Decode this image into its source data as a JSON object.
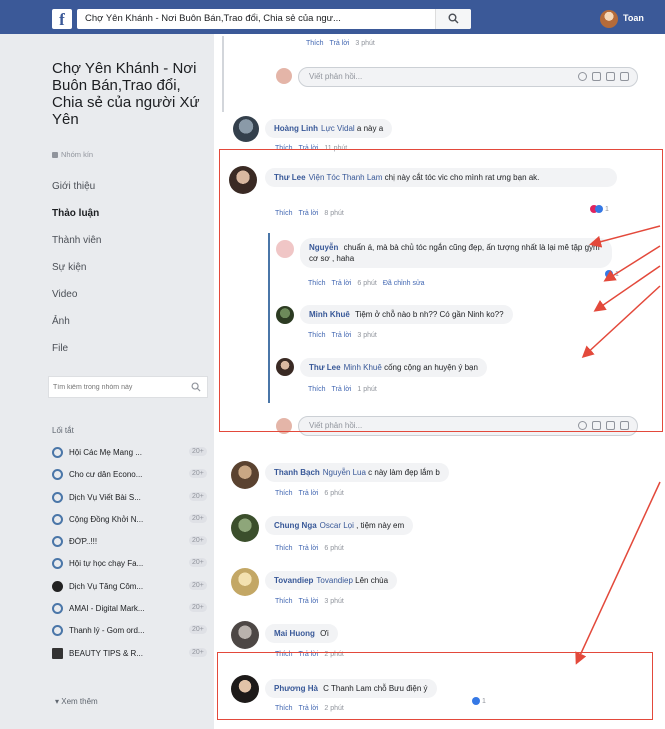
{
  "topbar": {
    "logo": "f",
    "search_value": "Chợ Yên Khánh - Nơi Buôn Bán,Trao đổi, Chia sẻ của ngư...",
    "user_name": "Toan"
  },
  "sidebar": {
    "group_title": "Chợ Yên Khánh - Nơi Buôn Bán,Trao đổi, Chia sẻ của người Xứ Yên",
    "group_type": "Nhóm kín",
    "nav": [
      "Giới thiệu",
      "Thảo luận",
      "Thành viên",
      "Sự kiện",
      "Video",
      "Ảnh",
      "File"
    ],
    "active_nav": "Thảo luận",
    "search_placeholder": "Tìm kiếm trong nhóm này",
    "shortcuts_title": "Lối tắt",
    "shortcuts": [
      {
        "label": "Hội Các Mẹ Mang ...",
        "badge": "20+"
      },
      {
        "label": "Cho cư dân Econo...",
        "badge": "20+"
      },
      {
        "label": "Dịch Vụ Viết Bài S...",
        "badge": "20+"
      },
      {
        "label": "Cộng Đồng Khởi N...",
        "badge": "20+"
      },
      {
        "label": "ĐỚP..!!!",
        "badge": "20+"
      },
      {
        "label": "Hội tự học chạy Fa...",
        "badge": "20+"
      },
      {
        "label": "Dịch Vụ Tăng Côm...",
        "badge": "20+"
      },
      {
        "label": "AMAI - Digital Mark...",
        "badge": "20+"
      },
      {
        "label": "Thanh lý - Gom ord...",
        "badge": "20+"
      },
      {
        "label": "BEAUTY TIPS & R...",
        "badge": "20+"
      }
    ],
    "see_more": "Xem thêm"
  },
  "actions": {
    "like": "Thích",
    "reply": "Trả lời",
    "edit": "Đã chỉnh sửa"
  },
  "reply_placeholder": "Viết phản hồi...",
  "top_meta": {
    "time": "3 phút"
  },
  "comments": [
    {
      "name": "Hoàng Linh",
      "tag": "Lực Vidal",
      "text": "a này a",
      "time": "11 phút"
    },
    {
      "name": "Thư Lee",
      "tag": "Viện Tóc Thanh Lam",
      "text": "chị này cắt tóc vic cho mình rat ưng bạn ak.",
      "time": "8 phút",
      "reactions": "1"
    },
    {
      "name": "Nguyễn",
      "tag": "",
      "text": "chuẩn á, mà bà chủ tóc ngắn cũng đẹp, ấn tượng nhất là lại mê tập gym cơ sơ , haha",
      "time": "6 phút",
      "reactions": "1"
    },
    {
      "name": "Minh Khuê",
      "tag": "",
      "text": "Tiệm ở chỗ nào b nh?? Có gần Ninh ko??",
      "time": "3 phút"
    },
    {
      "name": "Thư Lee",
      "tag": "Minh Khuê",
      "text": "cống cộng an huyện ý bạn",
      "time": "1 phút"
    },
    {
      "name": "Thanh Bạch",
      "tag": "Nguyễn Lua",
      "text": "c này làm đẹp lắm b",
      "time": "6 phút"
    },
    {
      "name": "Chung Nga",
      "tag": "Oscar Lọi",
      "text": ", tiệm này em",
      "time": "6 phút"
    },
    {
      "name": "Tovandiep",
      "tag": "Tovandiep",
      "text": "Lên chùa",
      "time": "3 phút"
    },
    {
      "name": "Mai Huong",
      "tag": "",
      "text": "Ơi",
      "time": "2 phút"
    },
    {
      "name": "Phương Hà",
      "tag": "",
      "text": "C Thanh Lam chỗ Bưu điện ý",
      "time": "2 phút",
      "reactions": "1"
    }
  ],
  "colors": {
    "fb_blue": "#3b5998",
    "link": "#385898",
    "annotation_red": "#e3493b"
  }
}
